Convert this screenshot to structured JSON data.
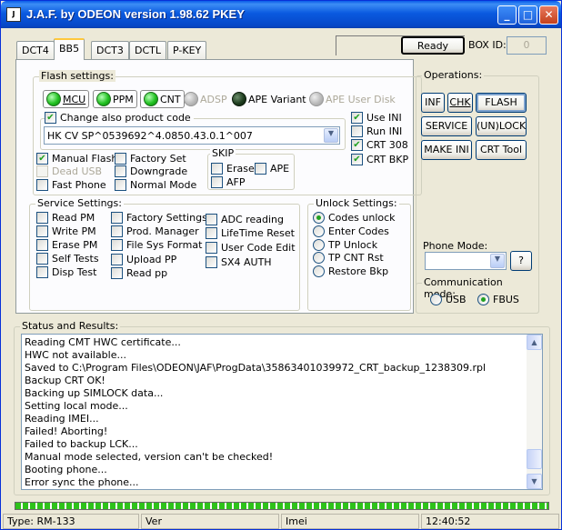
{
  "window": {
    "title": "J.A.F. by ODEON version 1.98.62 PKEY",
    "icon": "jaf-app-icon",
    "app_icon_text": "J"
  },
  "titlebar_buttons": {
    "minimize": "_",
    "maximize": "□",
    "close": "✕"
  },
  "top": {
    "ready_button": "Ready",
    "box_id_label": "BOX ID:",
    "box_id_value": "0"
  },
  "tabs": [
    {
      "label": "DCT4"
    },
    {
      "label": "BB5"
    },
    {
      "label": "DCT3"
    },
    {
      "label": "DCTL"
    },
    {
      "label": "P-KEY"
    }
  ],
  "flash": {
    "title": "Flash settings:",
    "leds": [
      {
        "label": "MCU",
        "state": "on"
      },
      {
        "label": "PPM",
        "state": "on"
      },
      {
        "label": "CNT",
        "state": "on"
      },
      {
        "label": "ADSP",
        "state": "disabled"
      },
      {
        "label": "APE Variant",
        "state": "dark"
      },
      {
        "label": "APE User Disk",
        "state": "disabled"
      }
    ],
    "change_product_code": "Change also product code",
    "product_code": "HK CV SP^0539692^4.0850.43.0.1^007",
    "right_checks": [
      {
        "label": "Use INI",
        "checked": true
      },
      {
        "label": "Run INI",
        "checked": false
      },
      {
        "label": "CRT 308",
        "checked": true
      },
      {
        "label": "CRT BKP",
        "checked": true
      }
    ],
    "col1": [
      {
        "label": "Manual Flash",
        "checked": true,
        "disabled": false
      },
      {
        "label": "Dead USB",
        "checked": false,
        "disabled": true
      },
      {
        "label": "Fast Phone",
        "checked": false,
        "disabled": false
      }
    ],
    "col2": [
      {
        "label": "Factory Set",
        "checked": false
      },
      {
        "label": "Downgrade",
        "checked": false
      },
      {
        "label": "Normal Mode",
        "checked": false
      }
    ],
    "skip": {
      "title": "SKIP",
      "erase": "Erase",
      "ape": "APE",
      "afp": "AFP"
    }
  },
  "service": {
    "title": "Service Settings:",
    "col1": [
      "Read PM",
      "Write PM",
      "Erase PM",
      "Self Tests",
      "Disp Test"
    ],
    "col2": [
      "Factory Settings",
      "Prod. Manager",
      "File Sys Format",
      "Upload PP",
      "Read pp"
    ],
    "col3": [
      "ADC reading",
      "LifeTime Reset",
      "User Code Edit",
      "SX4 AUTH"
    ]
  },
  "unlock": {
    "title": "Unlock Settings:",
    "options": [
      {
        "label": "Codes unlock",
        "selected": true
      },
      {
        "label": "Enter Codes",
        "selected": false
      },
      {
        "label": "TP Unlock",
        "selected": false
      },
      {
        "label": "TP CNT Rst",
        "selected": false
      },
      {
        "label": "Restore Bkp",
        "selected": false
      }
    ]
  },
  "operations": {
    "title": "Operations:",
    "inf": "INF",
    "chk": "CHK",
    "flash": "FLASH",
    "service": "SERVICE",
    "unlock": "(UN)LOCK",
    "make_ini": "MAKE INI",
    "crt_tool": "CRT Tool"
  },
  "phone_mode": {
    "title": "Phone Mode:",
    "value": "",
    "help": "?"
  },
  "comm": {
    "title": "Communication mode:",
    "usb": "USB",
    "fbus": "FBUS",
    "selected": "FBUS"
  },
  "status": {
    "title": "Status and Results:",
    "lines": [
      "Reading CMT HWC certificate...",
      "HWC not available...",
      "Saved to C:\\Program Files\\ODEON\\JAF\\ProgData\\35863401039972_CRT_backup_1238309.rpl",
      "Backup CRT OK!",
      "Backing up SIMLOCK data...",
      "Setting local mode...",
      "Reading IMEI...",
      "Failed! Aborting!",
      "Failed to backup LCK...",
      "Manual mode selected, version can't be checked!",
      "Booting phone...",
      "Error sync the phone..."
    ],
    "scroll_up": "▲",
    "scroll_down": "▼"
  },
  "progress": 1.0,
  "statusbar": {
    "type": "Type: RM-133",
    "ver": "Ver",
    "imei": "Imei",
    "time": "12:40:52"
  },
  "colors": {
    "title_blue": "#0a5ce8",
    "led_green": "#21c121",
    "progress_green": "#2ec21a"
  }
}
